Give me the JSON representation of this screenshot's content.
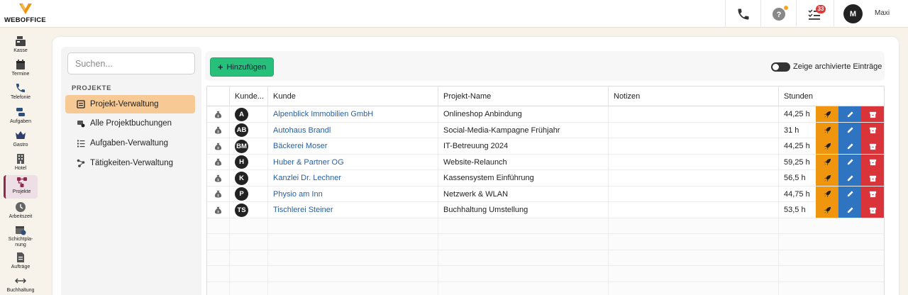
{
  "brand": {
    "name": "WEBOFFICE",
    "accent": "#f0960e"
  },
  "topbar": {
    "phone_icon": "phone-icon",
    "help_icon": "help-icon",
    "tasks_icon": "tasks-icon",
    "tasks_badge": "33",
    "user_initial": "M",
    "user_name": "Maxi"
  },
  "sidebar": {
    "items": [
      {
        "label": "Kasse",
        "icon": "cash-register-icon"
      },
      {
        "label": "Termine",
        "icon": "calendar-icon"
      },
      {
        "label": "Telefonie",
        "icon": "phone-icon"
      },
      {
        "label": "Aufgaben",
        "icon": "tasks-icon"
      },
      {
        "label": "Gastro",
        "icon": "crown-icon"
      },
      {
        "label": "Hotel",
        "icon": "hotel-icon"
      },
      {
        "label": "Projekte",
        "icon": "projects-icon",
        "active": true
      },
      {
        "label": "Arbeitszeit",
        "icon": "clock-icon"
      },
      {
        "label": "Schichtpla-nung",
        "icon": "shift-icon"
      },
      {
        "label": "Aufträge",
        "icon": "document-icon"
      },
      {
        "label": "Buchhaltung",
        "icon": "arrows-icon"
      }
    ]
  },
  "search": {
    "placeholder": "Suchen..."
  },
  "projects_menu": {
    "title": "PROJEKTE",
    "items": [
      {
        "label": "Projekt-Verwaltung",
        "active": true
      },
      {
        "label": "Alle Projektbuchungen"
      },
      {
        "label": "Aufgaben-Verwaltung"
      },
      {
        "label": "Tätigkeiten-Verwaltung"
      }
    ]
  },
  "toolbar": {
    "add_label": "Hinzufügen",
    "archive_toggle_label": "Zeige archivierte Einträge"
  },
  "table": {
    "columns": [
      "",
      "Kunde...",
      "Kunde",
      "Projekt-Name",
      "Notizen",
      "Stunden"
    ],
    "rows": [
      {
        "initials": "A",
        "customer": "Alpenblick Immobilien GmbH",
        "project": "Onlineshop Anbindung",
        "notes": "",
        "hours": "44,25 h"
      },
      {
        "initials": "AB",
        "customer": "Autohaus Brandl",
        "project": "Social-Media-Kampagne Frühjahr",
        "notes": "",
        "hours": "31 h"
      },
      {
        "initials": "BM",
        "customer": "Bäckerei Moser",
        "project": "IT-Betreuung 2024",
        "notes": "",
        "hours": "44,25 h"
      },
      {
        "initials": "H",
        "customer": "Huber & Partner OG",
        "project": "Website-Relaunch",
        "notes": "",
        "hours": "59,25 h"
      },
      {
        "initials": "K",
        "customer": "Kanzlei Dr. Lechner",
        "project": "Kassensystem Einführung",
        "notes": "",
        "hours": "56,5 h"
      },
      {
        "initials": "P",
        "customer": "Physio am Inn",
        "project": "Netzwerk & WLAN",
        "notes": "",
        "hours": "44,75 h"
      },
      {
        "initials": "TS",
        "customer": "Tischlerei Steiner",
        "project": "Buchhaltung Umstellung",
        "notes": "",
        "hours": "53,5 h"
      }
    ]
  }
}
